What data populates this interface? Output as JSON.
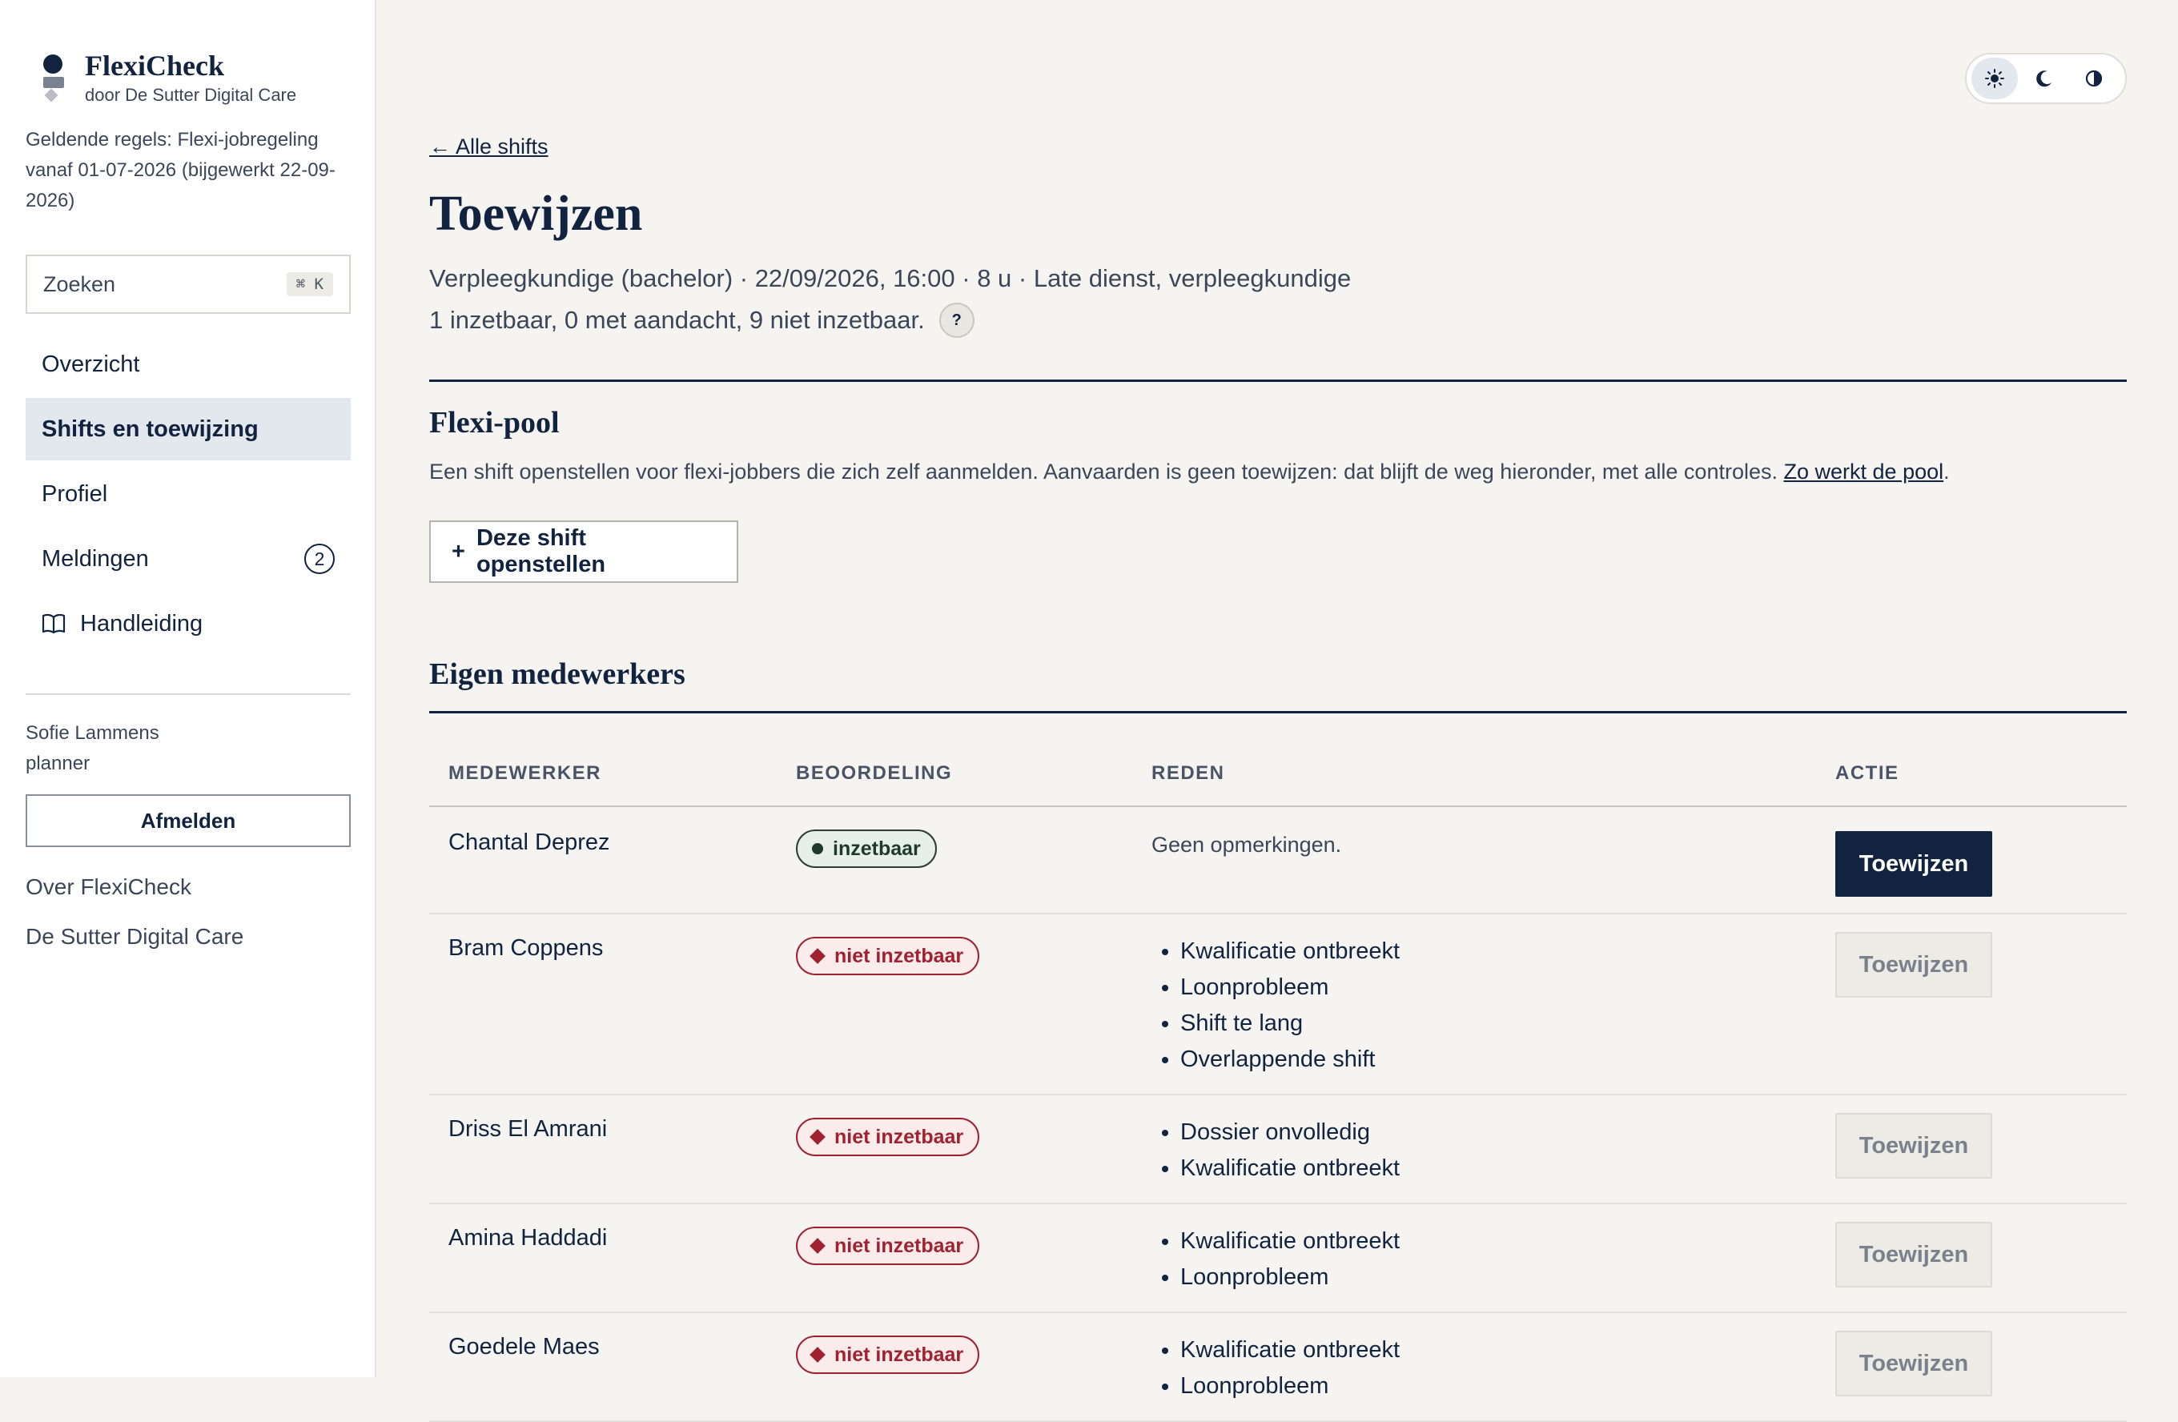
{
  "brand": {
    "name": "FlexiCheck",
    "sub": "door De Sutter Digital Care"
  },
  "rules_text": "Geldende regels: Flexi-jobregeling vanaf 01-07-2026 (bijgewerkt 22-09-2026)",
  "search": {
    "placeholder": "Zoeken",
    "shortcut": "⌘ K"
  },
  "nav": {
    "items": [
      {
        "label": "Overzicht"
      },
      {
        "label": "Shifts en toewijzing",
        "active": true
      },
      {
        "label": "Profiel"
      },
      {
        "label": "Meldingen",
        "badge": "2"
      },
      {
        "label": "Handleiding",
        "icon": "book-icon"
      }
    ]
  },
  "user": {
    "name": "Sofie Lammens",
    "role": "planner",
    "logout_label": "Afmelden"
  },
  "footer_links": [
    "Over FlexiCheck",
    "De Sutter Digital Care"
  ],
  "theme_toggle": {
    "options": [
      "sun-icon",
      "moon-icon",
      "contrast-icon"
    ],
    "active": "sun-icon"
  },
  "page": {
    "back_link": "← Alle shifts",
    "title": "Toewijzen",
    "subtitle": "Verpleegkundige (bachelor) · 22/09/2026, 16:00 · 8 u · Late dienst, verpleegkundige",
    "counts": "1 inzetbaar, 0 met aandacht, 9 niet inzetbaar.",
    "help_label": "?"
  },
  "pool": {
    "title": "Flexi-pool",
    "description": "Een shift openstellen voor flexi-jobbers die zich zelf aanmelden. Aanvaarden is geen toewijzen: dat blijft de weg hieronder, met alle controles.",
    "link_text": "Zo werkt de pool",
    "link_suffix": ".",
    "open_button": "Deze shift openstellen",
    "open_button_icon": "+"
  },
  "staff": {
    "title": "Eigen medewerkers",
    "headers": {
      "name": "MEDEWERKER",
      "rating": "BEOORDELING",
      "reason": "REDEN",
      "action": "ACTIE"
    },
    "action_label": "Toewijzen",
    "rows": [
      {
        "name": "Chantal Deprez",
        "rating": "inzetbaar",
        "status": "ok",
        "reason_text": "Geen opmerkingen.",
        "reasons": []
      },
      {
        "name": "Bram Coppens",
        "rating": "niet inzetbaar",
        "status": "bad",
        "reasons": [
          "Kwalificatie ontbreekt",
          "Loonprobleem",
          "Shift te lang",
          "Overlappende shift"
        ]
      },
      {
        "name": "Driss El Amrani",
        "rating": "niet inzetbaar",
        "status": "bad",
        "reasons": [
          "Dossier onvolledig",
          "Kwalificatie ontbreekt"
        ]
      },
      {
        "name": "Amina Haddadi",
        "rating": "niet inzetbaar",
        "status": "bad",
        "reasons": [
          "Kwalificatie ontbreekt",
          "Loonprobleem"
        ]
      },
      {
        "name": "Goedele Maes",
        "rating": "niet inzetbaar",
        "status": "bad",
        "reasons": [
          "Kwalificatie ontbreekt",
          "Loonprobleem"
        ]
      }
    ]
  },
  "colors": {
    "navy": "#12233f",
    "danger": "#a0212f",
    "ok": "#1f3a2a",
    "background": "#f5f4f0"
  }
}
